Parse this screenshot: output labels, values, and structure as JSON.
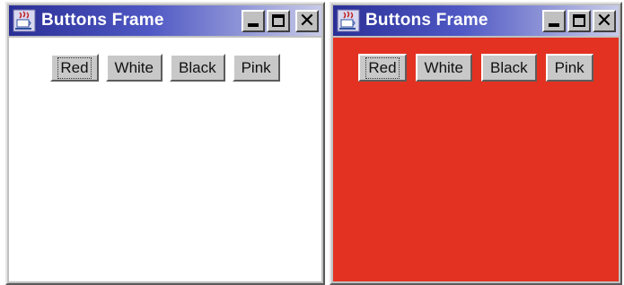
{
  "windows": [
    {
      "title": "Buttons Frame",
      "content_background": "#ffffff",
      "buttons": {
        "red": "Red",
        "white": "White",
        "black": "Black",
        "pink": "Pink"
      },
      "focused_button": "Red"
    },
    {
      "title": "Buttons Frame",
      "content_background": "#e33222",
      "buttons": {
        "red": "Red",
        "white": "White",
        "black": "Black",
        "pink": "Pink"
      },
      "focused_button": "Red"
    }
  ],
  "icons": {
    "app": "java-cup-icon",
    "minimize": "minimize-icon",
    "maximize": "maximize-icon",
    "close": "close-icon"
  },
  "colors": {
    "titlebar_start": "#2a2f96",
    "titlebar_end": "#c8cbe8",
    "window_chrome": "#c0c0c0",
    "red": "#e33222"
  }
}
